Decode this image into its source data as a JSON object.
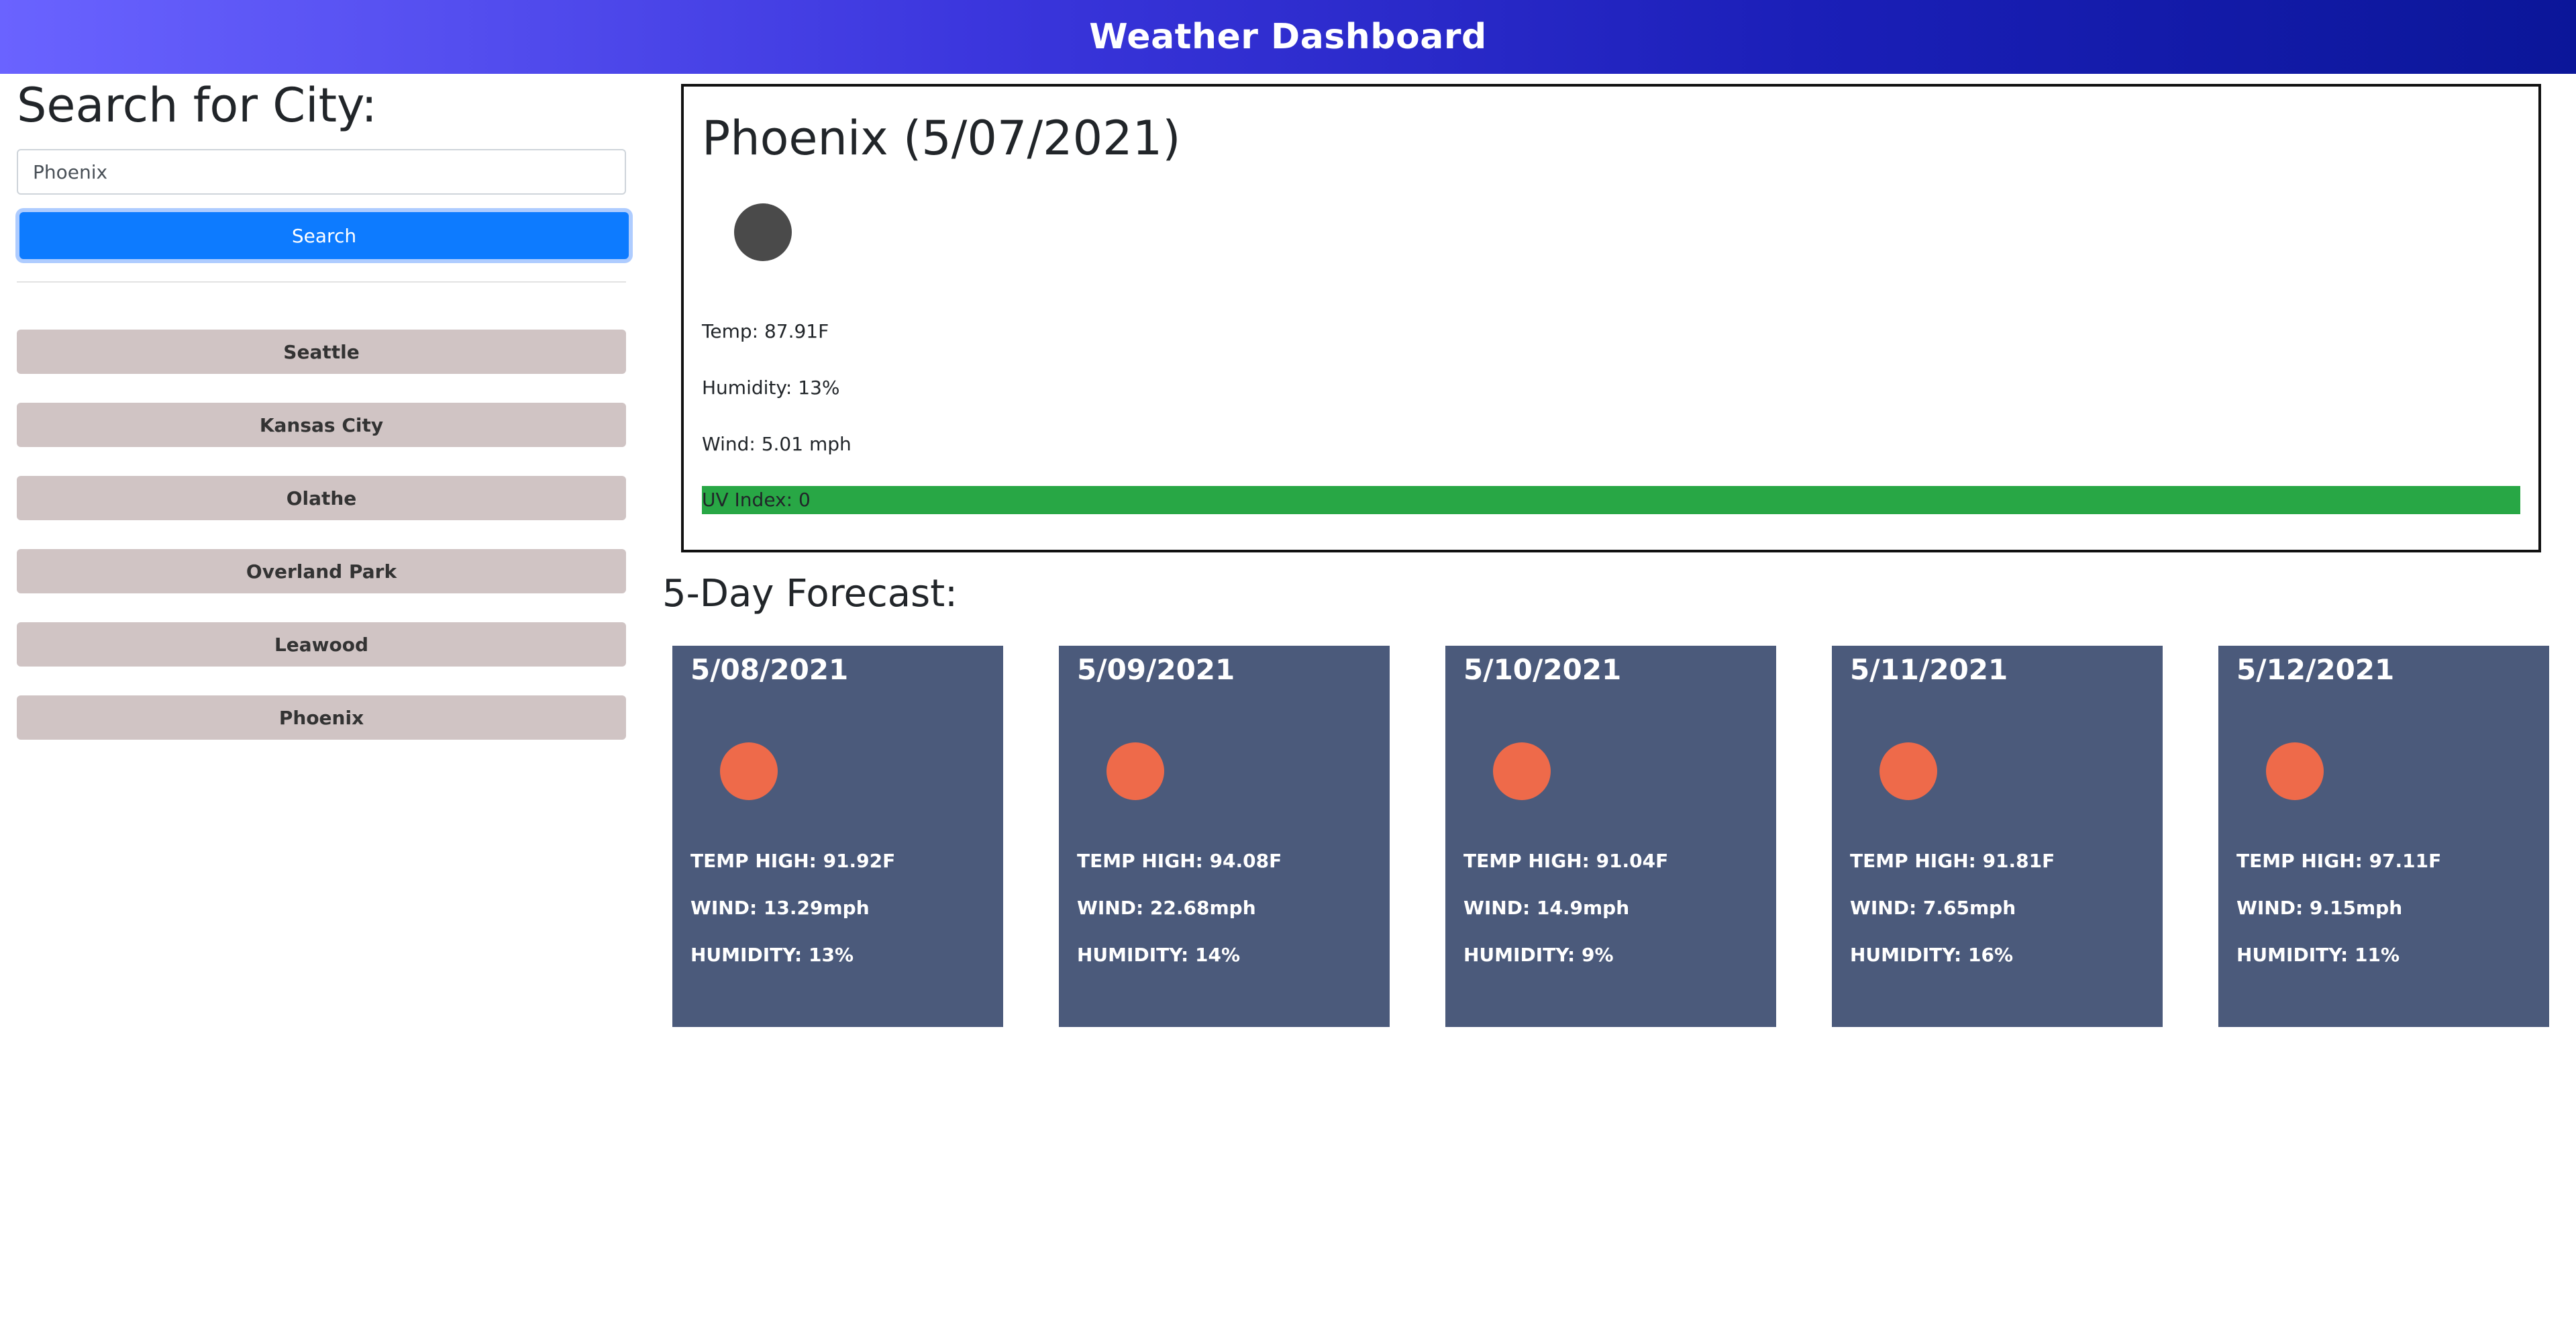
{
  "header": {
    "title": "Weather Dashboard"
  },
  "sidebar": {
    "title": "Search for City:",
    "search_value": "Phoenix",
    "search_button": "Search",
    "history": [
      "Seattle",
      "Kansas City",
      "Olathe",
      "Overland Park",
      "Leawood",
      "Phoenix"
    ]
  },
  "current": {
    "city_date": "Phoenix (5/07/2021)",
    "icon": "dark-circle-weather-icon",
    "temp": "Temp: 87.91F",
    "humidity": "Humidity: 13%",
    "wind": "Wind: 5.01 mph",
    "uv": "UV Index: 0",
    "uv_color": "#28a745"
  },
  "forecast": {
    "title": "5-Day Forecast:",
    "card_color": "#4b5a7b",
    "sun_color": "#ee6a4a",
    "days": [
      {
        "date": "5/08/2021",
        "temp": "TEMP HIGH: 91.92F",
        "wind": "WIND: 13.29mph",
        "humidity": "HUMIDITY: 13%"
      },
      {
        "date": "5/09/2021",
        "temp": "TEMP HIGH: 94.08F",
        "wind": "WIND: 22.68mph",
        "humidity": "HUMIDITY: 14%"
      },
      {
        "date": "5/10/2021",
        "temp": "TEMP HIGH: 91.04F",
        "wind": "WIND: 14.9mph",
        "humidity": "HUMIDITY: 9%"
      },
      {
        "date": "5/11/2021",
        "temp": "TEMP HIGH: 91.81F",
        "wind": "WIND: 7.65mph",
        "humidity": "HUMIDITY: 16%"
      },
      {
        "date": "5/12/2021",
        "temp": "TEMP HIGH: 97.11F",
        "wind": "WIND: 9.15mph",
        "humidity": "HUMIDITY: 11%"
      }
    ]
  }
}
